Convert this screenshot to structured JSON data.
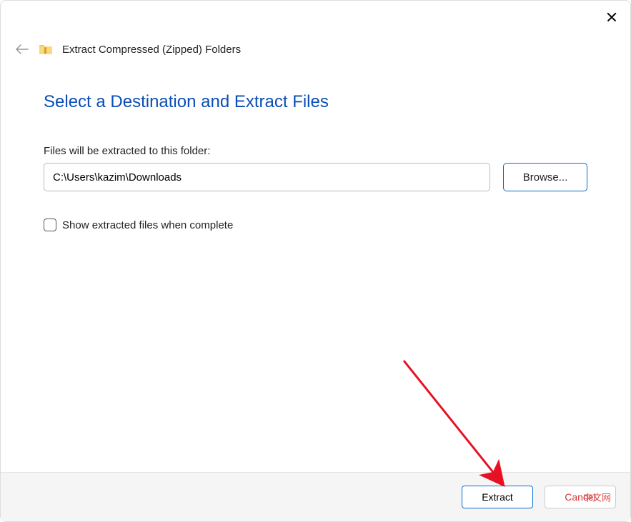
{
  "window": {
    "title": "Extract Compressed (Zipped) Folders"
  },
  "content": {
    "heading": "Select a Destination and Extract Files",
    "path_label": "Files will be extracted to this folder:",
    "path_value": "C:\\Users\\kazim\\Downloads",
    "browse_label": "Browse...",
    "checkbox_label": "Show extracted files when complete"
  },
  "footer": {
    "extract_label": "Extract",
    "cancel_label": "Cancel"
  },
  "watermark": "中文网"
}
